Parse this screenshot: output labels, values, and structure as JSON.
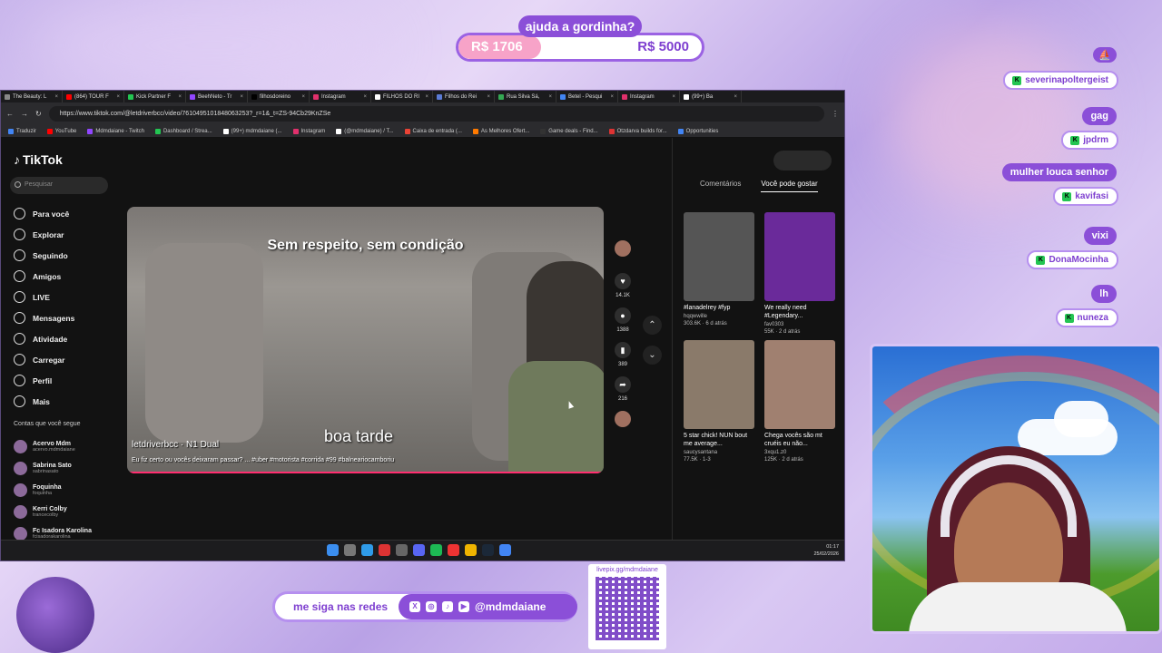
{
  "overlay": {
    "goal": {
      "title": "ajuda a gordinha?",
      "current": "R$ 1706",
      "target": "R$ 5000",
      "progress_fraction": 0.3412
    },
    "social_label": "me siga nas redes",
    "social_handle": "@mdmdaiane",
    "qr_label": "livepix.gg/mdmdaiane",
    "accent": "#8b4fd8"
  },
  "browser": {
    "tabs": [
      {
        "label": "The Beauty: L",
        "color": "#888"
      },
      {
        "label": "(864) TOUR F",
        "color": "#ff0000"
      },
      {
        "label": "Kick Partner F",
        "color": "#23c552"
      },
      {
        "label": "BeehNeto - Tr",
        "color": "#9146ff"
      },
      {
        "label": "filhosdoreino",
        "color": "#000"
      },
      {
        "label": "Instagram",
        "color": "#e1306c"
      },
      {
        "label": "FILHOS DO RI",
        "color": "#fff"
      },
      {
        "label": "Filhos do Rei",
        "color": "#5b7bd5"
      },
      {
        "label": "Rua Silva Sá,",
        "color": "#34a853"
      },
      {
        "label": "Betel - Pesqui",
        "color": "#4285f4"
      },
      {
        "label": "Instagram",
        "color": "#e1306c"
      },
      {
        "label": "(99+) Ba",
        "color": "#fff"
      }
    ],
    "url": "https://www.tiktok.com/@letdriverbcc/video/7610495101848063253?_r=1&_t=ZS-94Cb29KnZSe",
    "bookmarks": [
      {
        "label": "Traduzir",
        "color": "#4285f4"
      },
      {
        "label": "YouTube",
        "color": "#ff0000"
      },
      {
        "label": "Mdmdaiane - Twitch",
        "color": "#9146ff"
      },
      {
        "label": "Dashboard / Strea...",
        "color": "#23c552"
      },
      {
        "label": "(99+) mdmdaiane (...",
        "color": "#fff"
      },
      {
        "label": "Instagram",
        "color": "#e1306c"
      },
      {
        "label": "(@mdmdaiane) / T...",
        "color": "#fff"
      },
      {
        "label": "Caixa de entrada (...",
        "color": "#ea4335"
      },
      {
        "label": "As Melhores Ofert...",
        "color": "#ff7a00"
      },
      {
        "label": "Game deals - Find...",
        "color": "#333"
      },
      {
        "label": "Otzdarva builds for...",
        "color": "#d33"
      },
      {
        "label": "Opportunities",
        "color": "#4285f4"
      }
    ],
    "taskbar_time": "01:17",
    "taskbar_date": "25/02/2026"
  },
  "tiktok": {
    "logo": "TikTok",
    "search_placeholder": "Pesquisar",
    "nav": [
      "Para você",
      "Explorar",
      "Seguindo",
      "Amigos",
      "LIVE",
      "Mensagens",
      "Atividade",
      "Carregar",
      "Perfil",
      "Mais"
    ],
    "following_title": "Contas que você segue",
    "following": [
      {
        "name": "Acervo Mdm",
        "user": "acervo.mdmdaiane"
      },
      {
        "name": "Sabrina Sato",
        "user": "sabrinasato"
      },
      {
        "name": "Foquinha",
        "user": "foquinha"
      },
      {
        "name": "Kerri Colby",
        "user": "trancecolby"
      },
      {
        "name": "Fc Isadora Karolina",
        "user": "fcisadorakarolina"
      }
    ],
    "video": {
      "caption_top": "Sem respeito, sem condição",
      "caption_mid": "boa tarde",
      "username": "letdriverbcc · N1 Dual",
      "desc": "Eu fiz certo ou vocês deixaram passar? ... #uber #motorista #corrida #99 #balneariocamboriu"
    },
    "actions": {
      "likes": "14.1K",
      "comments": "1388",
      "saves": "389",
      "shares": "216"
    },
    "tabs": [
      "Comentários",
      "Você pode gostar"
    ],
    "suggested": [
      {
        "title": "#lanadelrey #fyp",
        "user": "hqqwwille",
        "meta": "303.6K · 6 d atrás",
        "color": "#555"
      },
      {
        "title": "We really need #Legendary...",
        "user": "fav0303",
        "meta": "55K · 2 d atrás",
        "color": "#6a2a9a"
      },
      {
        "title": "5 star chick! NUN bout me average...",
        "user": "saucysantana",
        "meta": "77.5K · 1-3",
        "color": "#8a7a6a"
      },
      {
        "title": "Chega vocês são mt cruéis eu não...",
        "user": "3xqu1.z0",
        "meta": "125K · 2 d atrás",
        "color": "#a08070"
      }
    ]
  },
  "chat": [
    {
      "message": "",
      "user": "severinapoltergeist"
    },
    {
      "message": "gag",
      "user": "jpdrm"
    },
    {
      "message": "mulher louca senhor",
      "user": "kavifasi"
    },
    {
      "message": "vixi",
      "user": "DonaMocinha"
    },
    {
      "message": "lh",
      "user": "nuneza"
    }
  ]
}
